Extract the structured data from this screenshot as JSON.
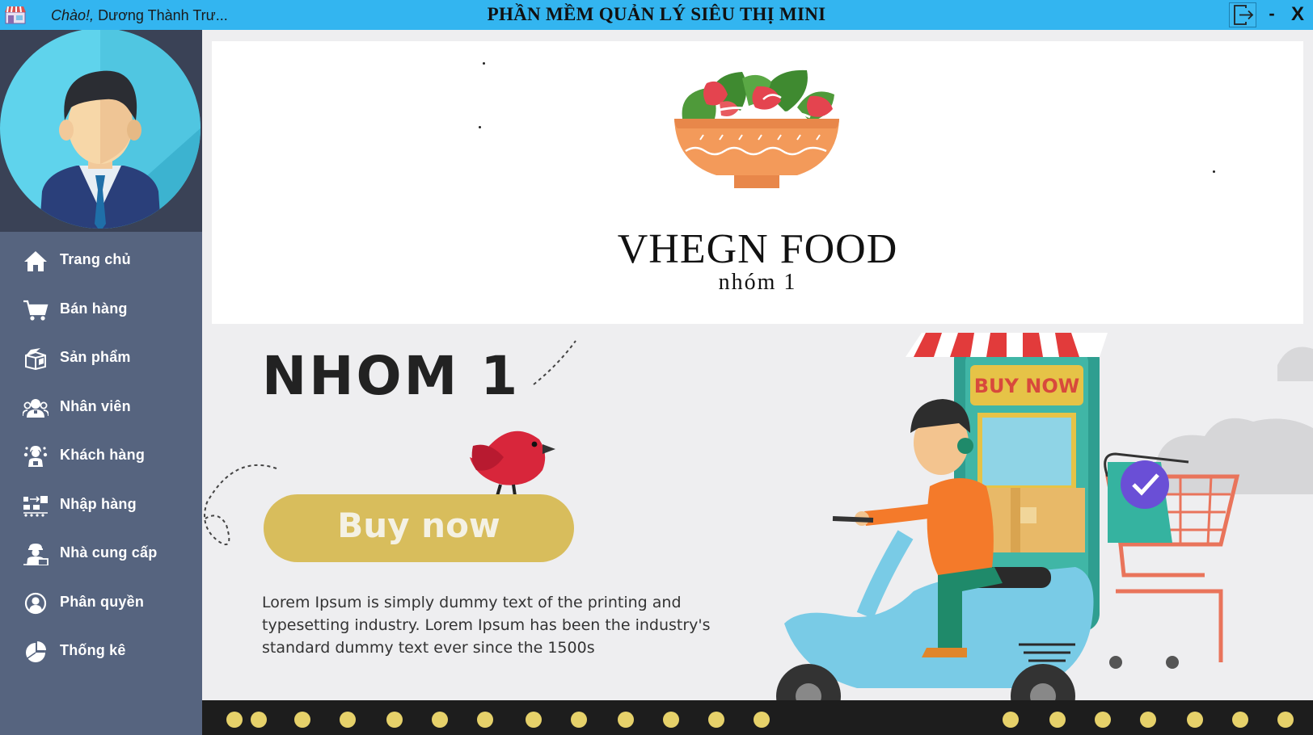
{
  "titlebar": {
    "greeting_prefix": "Chào!,",
    "greeting_name": "Dương Thành Trư...",
    "app_title": "PHẦN MỀM QUẢN LÝ SIÊU THỊ MINI",
    "minimize_label": "-",
    "close_label": "X",
    "background": "#33b5f0"
  },
  "sidebar": {
    "background": "#56647f",
    "items": [
      {
        "label": "Trang chủ",
        "icon": "home-icon"
      },
      {
        "label": "Bán hàng",
        "icon": "cart-icon"
      },
      {
        "label": "Sản phẩm",
        "icon": "product-box-icon"
      },
      {
        "label": "Nhân viên",
        "icon": "employees-icon"
      },
      {
        "label": "Khách hàng",
        "icon": "customer-icon"
      },
      {
        "label": "Nhập hàng",
        "icon": "import-icon"
      },
      {
        "label": "Nhà cung cấp",
        "icon": "supplier-icon"
      },
      {
        "label": "Phân quyền",
        "icon": "permission-user-icon"
      },
      {
        "label": "Thống kê",
        "icon": "pie-chart-icon"
      }
    ]
  },
  "header": {
    "brand": "VHEGN FOOD",
    "group": "nhóm 1"
  },
  "banner": {
    "heading": "NHOM 1",
    "button_label": "Buy now",
    "sign_text": "BUY NOW",
    "lorem_line1": "Lorem Ipsum is simply dummy text of the printing and",
    "lorem_line2": "typesetting industry. Lorem Ipsum has been the industry's",
    "lorem_line3": "standard dummy text ever since the 1500s"
  }
}
